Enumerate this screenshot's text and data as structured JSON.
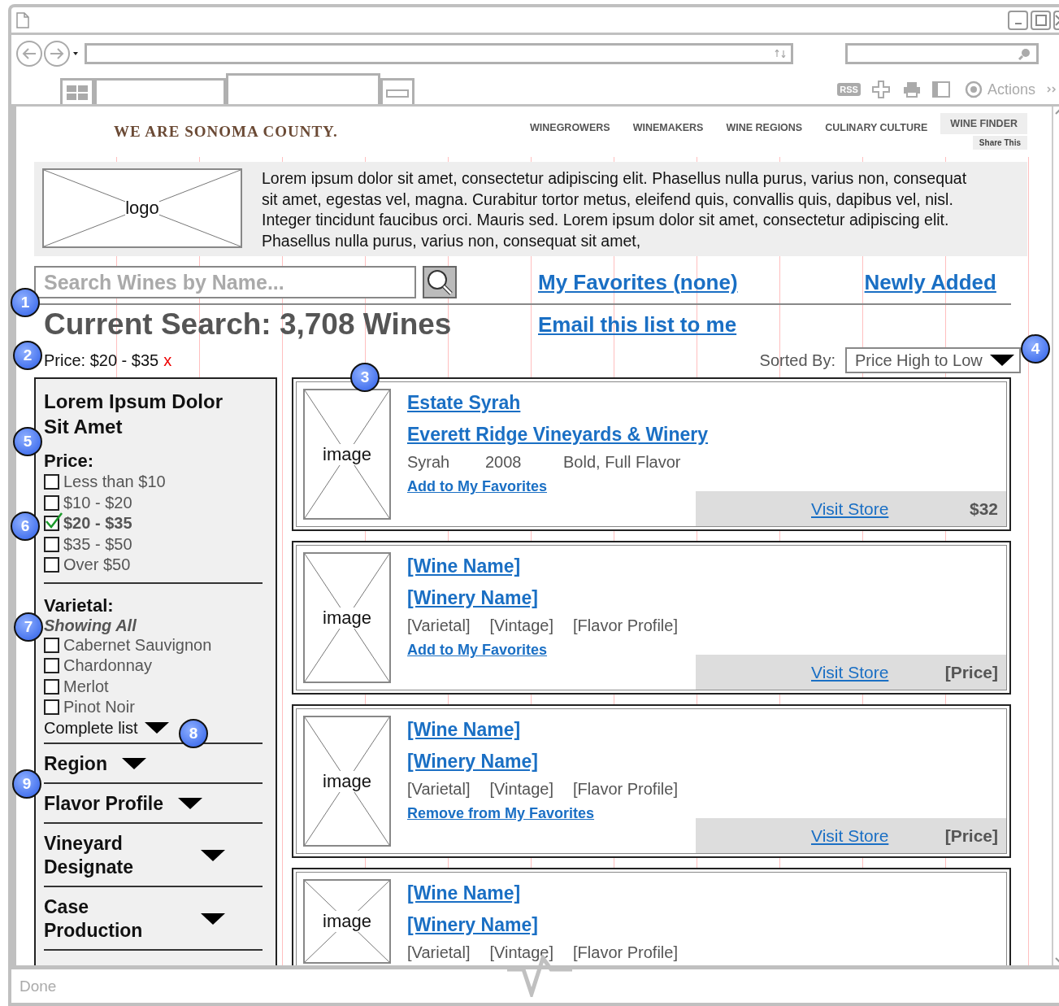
{
  "browser": {
    "toolbar": {
      "rss": "RSS",
      "actions": "Actions"
    },
    "status": "Done"
  },
  "site": {
    "brand": "WE ARE SONOMA COUNTY.",
    "nav": [
      {
        "label": "WINEGROWERS",
        "selected": false
      },
      {
        "label": "WINEMAKERS",
        "selected": false
      },
      {
        "label": "WINE REGIONS",
        "selected": false
      },
      {
        "label": "CULINARY CULTURE",
        "selected": false
      },
      {
        "label": "WINE FINDER",
        "selected": true
      }
    ],
    "share": "Share This"
  },
  "banner": {
    "logo": "logo",
    "text": "Lorem ipsum dolor sit amet, consectetur adipiscing elit. Phasellus nulla purus, varius non, consequat sit amet, egestas vel, magna. Curabitur tortor metus, eleifend quis, convallis quis, dapibus vel, nisl. Integer tincidunt faucibus orci. Mauris sed. Lorem ipsum dolor sit amet, consectetur adipiscing elit. Phasellus nulla purus, varius non, consequat sit amet,"
  },
  "search": {
    "placeholder": "Search Wines by Name..."
  },
  "links": {
    "favorites": "My Favorites (none)",
    "newly_added": "Newly Added",
    "email": "Email this list to me"
  },
  "heading": "Current Search: 3,708 Wines",
  "active_filter": {
    "label": "Price: $20 - $35",
    "remove": "x"
  },
  "sort": {
    "label": "Sorted By:",
    "value": "Price High to Low"
  },
  "filters": {
    "title": "Lorem Ipsum Dolor Sit Amet",
    "price": {
      "title": "Price:",
      "options": [
        {
          "label": "Less than $10",
          "checked": false
        },
        {
          "label": "$10 - $20",
          "checked": false
        },
        {
          "label": "$20 - $35",
          "checked": true
        },
        {
          "label": "$35 - $50",
          "checked": false
        },
        {
          "label": "Over $50",
          "checked": false
        }
      ]
    },
    "varietal": {
      "title": "Varietal:",
      "note": "Showing All",
      "options": [
        {
          "label": "Cabernet Sauvignon",
          "checked": false
        },
        {
          "label": "Chardonnay",
          "checked": false
        },
        {
          "label": "Merlot",
          "checked": false
        },
        {
          "label": "Pinot Noir",
          "checked": false
        }
      ],
      "more": "Complete list"
    },
    "sections": [
      {
        "label": "Region"
      },
      {
        "label": "Flavor Profile"
      },
      {
        "label": "Vineyard Designate"
      },
      {
        "label": "Case Production"
      }
    ]
  },
  "results": [
    {
      "image": "image",
      "name": "Estate Syrah",
      "winery": "Everett Ridge Vineyards & Winery",
      "details": [
        "Syrah",
        "2008",
        "Bold, Full Flavor"
      ],
      "action": "Add to My Favorites",
      "store": "Visit Store",
      "price": "$32"
    },
    {
      "image": "image",
      "name": "[Wine Name]",
      "winery": "[Winery Name]",
      "details": [
        "[Varietal]",
        "[Vintage]",
        "[Flavor Profile]"
      ],
      "action": "Add to My Favorites",
      "store": "Visit Store",
      "price": "[Price]"
    },
    {
      "image": "image",
      "name": "[Wine Name]",
      "winery": "[Winery Name]",
      "details": [
        "[Varietal]",
        "[Vintage]",
        "[Flavor Profile]"
      ],
      "action": "Remove from My Favorites",
      "store": "Visit Store",
      "price": "[Price]"
    },
    {
      "image": "image",
      "name": "[Wine Name]",
      "winery": "[Winery Name]",
      "details": [
        "[Varietal]",
        "[Vintage]",
        "[Flavor Profile]"
      ]
    }
  ],
  "callouts": [
    "1",
    "2",
    "3",
    "4",
    "5",
    "6",
    "7",
    "8",
    "9"
  ]
}
